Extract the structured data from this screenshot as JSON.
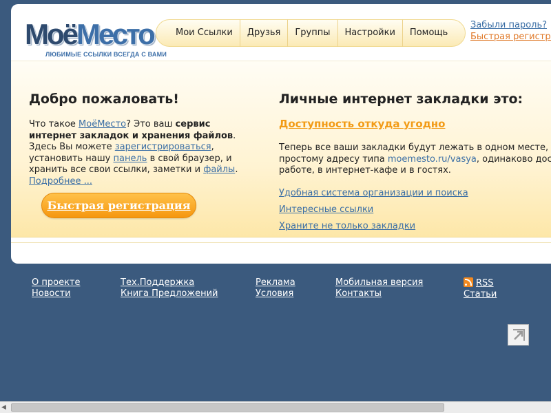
{
  "logo": {
    "word_part1": "Моё",
    "word_part2": "Место",
    "tagline": "ЛЮБИМЫЕ ССЫЛКИ ВСЕГДА С ВАМИ"
  },
  "nav": [
    "Мои Ссылки",
    "Друзья",
    "Группы",
    "Настройки",
    "Помощь"
  ],
  "login": {
    "forgot": "Забыли пароль?",
    "quick_reg": "Быстрая регистрация"
  },
  "welcome": {
    "title": "Добро пожаловать!",
    "t1": "Что такое ",
    "l1": "МоёМесто",
    "t2": "? Это ваш ",
    "b1": "сервис интернет закладок и хранения файлов",
    "t3": ". Здесь Вы можете ",
    "l2": "зарегистрироваться",
    "t4": ", установить нашу ",
    "l3": "панель",
    "t5": " в свой браузер, и хранить все свои ссылки, заметки и ",
    "l4": "файлы",
    "t6": ".",
    "more": "Подробнее ...",
    "button": "Быстрая регистрация"
  },
  "features": {
    "title": "Личные интернет закладки это:",
    "highlight": "Доступность откуда угодно",
    "line1": "Теперь все ваши закладки будут лежать в одном месте, л",
    "line2a": "простому адресу типа ",
    "line2_link": "moemesto.ru/vasya",
    "line2b": ", одинаково дост",
    "line3": "работе, в интернет-кафе и в гостях.",
    "links": [
      "Удобная система организации и поиска",
      "Интересные ссылки",
      "Храните не только закладки"
    ]
  },
  "footer": {
    "col1": [
      "О проекте",
      "Новости"
    ],
    "col2": [
      "Тех.Поддержка",
      "Книга Предложений"
    ],
    "col3": [
      "Реклама",
      "Условия"
    ],
    "col4": [
      "Мобильная версия",
      "Контакты"
    ],
    "col5": [
      "RSS",
      "Статьи"
    ]
  },
  "colors": {
    "background": "#3b5a7e",
    "link": "#3a6ea5",
    "accent": "#f29b16"
  }
}
